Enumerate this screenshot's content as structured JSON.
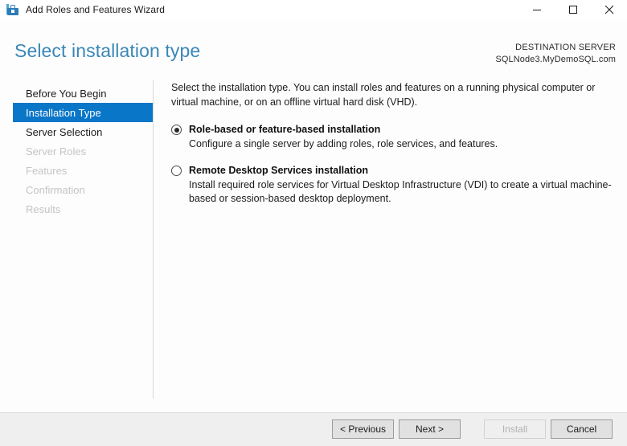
{
  "window": {
    "title": "Add Roles and Features Wizard",
    "icon": "toolbox-icon",
    "controls": {
      "minimize": "minimize-icon",
      "maximize": "maximize-icon",
      "close": "close-icon"
    }
  },
  "header": {
    "page_title": "Select installation type",
    "destination_label": "DESTINATION SERVER",
    "destination_server": "SQLNode3.MyDemoSQL.com"
  },
  "sidebar": {
    "items": [
      {
        "label": "Before You Begin",
        "state": "enabled"
      },
      {
        "label": "Installation Type",
        "state": "selected"
      },
      {
        "label": "Server Selection",
        "state": "enabled"
      },
      {
        "label": "Server Roles",
        "state": "disabled"
      },
      {
        "label": "Features",
        "state": "disabled"
      },
      {
        "label": "Confirmation",
        "state": "disabled"
      },
      {
        "label": "Results",
        "state": "disabled"
      }
    ]
  },
  "main": {
    "intro": "Select the installation type. You can install roles and features on a running physical computer or virtual machine, or on an offline virtual hard disk (VHD).",
    "options": [
      {
        "title": "Role-based or feature-based installation",
        "description": "Configure a single server by adding roles, role services, and features.",
        "selected": true
      },
      {
        "title": "Remote Desktop Services installation",
        "description": "Install required role services for Virtual Desktop Infrastructure (VDI) to create a virtual machine-based or session-based desktop deployment.",
        "selected": false
      }
    ]
  },
  "footer": {
    "buttons": [
      {
        "label": "< Previous",
        "enabled": true
      },
      {
        "label": "Next >",
        "enabled": true
      },
      {
        "label": "Install",
        "enabled": false
      },
      {
        "label": "Cancel",
        "enabled": true
      }
    ]
  },
  "colors": {
    "accent_selected": "#0a76c8",
    "title_blue": "#3a87b7",
    "footer_bg": "#efefef",
    "disabled_text": "#c4c4c4"
  }
}
